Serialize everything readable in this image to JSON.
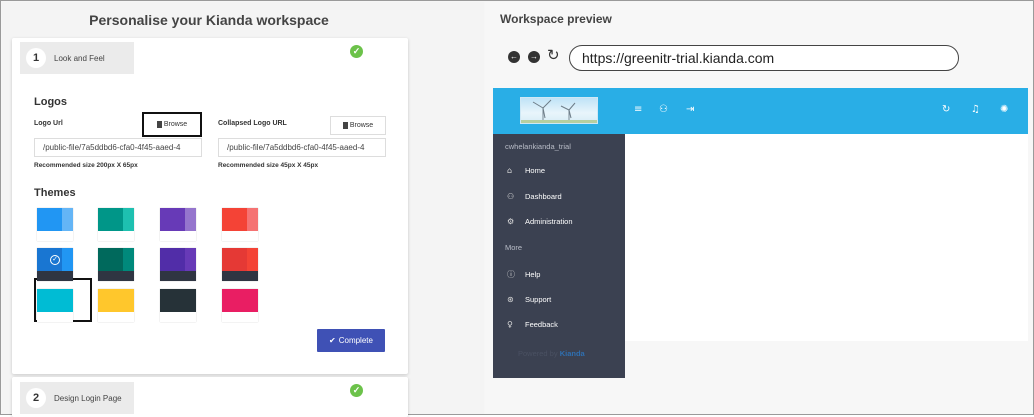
{
  "left": {
    "title": "Personalise your Kianda workspace",
    "step1": {
      "num": "1",
      "label": "Look and Feel"
    },
    "step2": {
      "num": "2",
      "label": "Design Login Page"
    },
    "logos_heading": "Logos",
    "logo_url_label": "Logo Url",
    "collapsed_logo_label": "Collapsed Logo URL",
    "browse_label": "Browse",
    "logo_url_value": "/public-file/7a5ddbd6-cfa0-4f45-aaed-4",
    "collapsed_logo_value": "/public-file/7a5ddbd6-cfa0-4f45-aaed-4",
    "logo_rec": "Recommended size 200px X 65px",
    "collapsed_rec": "Recommended size 45px X 45px",
    "themes_heading": "Themes",
    "complete_label": "Complete",
    "themes": [
      {
        "main": "#2196f3",
        "accent": "#64b5f6",
        "bottom": "#ffffff"
      },
      {
        "main": "#009688",
        "accent": "#1ec0b0",
        "bottom": "#ffffff"
      },
      {
        "main": "#673ab7",
        "accent": "#9575cd",
        "bottom": "#ffffff"
      },
      {
        "main": "#f44336",
        "accent": "#f57373",
        "bottom": "#ffffff"
      },
      {
        "main": "#1976d2",
        "accent": "#2196f3",
        "bottom": "#2f3542"
      },
      {
        "main": "#00695c",
        "accent": "#00897b",
        "bottom": "#2f3542"
      },
      {
        "main": "#512da8",
        "accent": "#673ab7",
        "bottom": "#2f3542"
      },
      {
        "main": "#e53935",
        "accent": "#f44336",
        "bottom": "#2f3542"
      },
      {
        "main": "#00bcd4",
        "accent": "#00bcd4",
        "bottom": "#ffffff"
      },
      {
        "main": "#ffc72c",
        "accent": "#ffc72c",
        "bottom": "#ffffff"
      },
      {
        "main": "#263238",
        "accent": "#263238",
        "bottom": "#ffffff"
      },
      {
        "main": "#e91e63",
        "accent": "#e91e63",
        "bottom": "#ffffff"
      }
    ],
    "selected_theme": 4
  },
  "right": {
    "title": "Workspace preview",
    "url": "https://greenitr-trial.kianda.com",
    "sidebar": {
      "user": "cwhelankianda_trial",
      "items": [
        {
          "label": "Home",
          "icon": "home-icon"
        },
        {
          "label": "Dashboard",
          "icon": "dashboard-icon"
        },
        {
          "label": "Administration",
          "icon": "settings-icon"
        }
      ],
      "more": "More",
      "more_items": [
        {
          "label": "Help",
          "icon": "info-icon"
        },
        {
          "label": "Support",
          "icon": "support-icon"
        },
        {
          "label": "Feedback",
          "icon": "lightbulb-icon"
        }
      ],
      "powered_by": "Powered by",
      "brand": "Kianda"
    }
  },
  "colors": {
    "appbar": "#29aee6",
    "sidebar": "#3b4151",
    "complete": "#3f51b5",
    "done": "#6cc24a"
  }
}
